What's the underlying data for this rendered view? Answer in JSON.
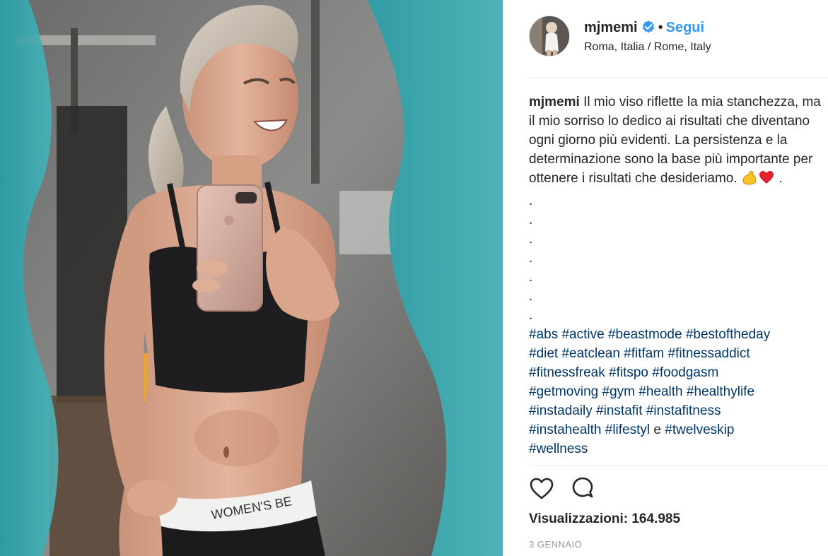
{
  "post": {
    "username": "mjmemi",
    "follow_label": "Segui",
    "separator": "•",
    "location": "Roma, Italia / Rome, Italy",
    "caption_user": "mjmemi",
    "caption_text": "Il mio viso riflette la mia stanchezza, ma il mio sorriso lo dedico ai risultati che diventano ogni giorno più evidenti. La persistenza e la determinazione sono la base più importante per ottenere i risultati che desideriamo.",
    "caption_trailing": ".",
    "dots": [
      ".",
      ".",
      ".",
      ".",
      ".",
      ".",
      "."
    ],
    "hashtags_line1": [
      "#abs",
      "#active",
      "#beastmode",
      "#bestoftheday"
    ],
    "hashtags_line2": [
      "#diet",
      "#eatclean",
      "#fitfam",
      "#fitnessaddict"
    ],
    "hashtags_line3": [
      "#fitnessfreak",
      "#fitspo",
      "#foodgasm"
    ],
    "hashtags_line4": [
      "#getmoving",
      "#gym",
      "#health",
      "#healthylife"
    ],
    "hashtags_line5": [
      "#instadaily",
      "#instafit",
      "#instafitness"
    ],
    "hashtags_line6": [
      "#instahealth",
      "#lifestyl"
    ],
    "hashtags_conj": "e",
    "hashtags_line6_end": "#twelveskip",
    "hashtags_line7": [
      "#wellness"
    ],
    "views_label": "Visualizzazioni:",
    "views_count": "164.985",
    "date": "3 GENNAIO"
  },
  "icons": {
    "verified": "verified-badge-icon",
    "like": "heart-outline-icon",
    "comment": "comment-bubble-icon",
    "emoji1": "flexed-biceps-emoji",
    "emoji2": "red-heart-emoji"
  },
  "colors": {
    "link_blue": "#3897f0",
    "hashtag": "#003569",
    "text": "#262626",
    "muted": "#999999",
    "border": "#efefef",
    "photo_teal": "#3c9ea6"
  }
}
